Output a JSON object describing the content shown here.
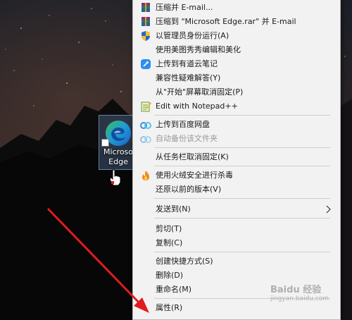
{
  "desktop": {
    "icon_label_line1": "Microso",
    "icon_label_line2": "Edge"
  },
  "context_menu": {
    "items": [
      {
        "label": "压缩并 E-mail...",
        "icon": "winrar-icon"
      },
      {
        "label": "压缩到 \"Microsoft Edge.rar\" 并 E-mail",
        "icon": "winrar-icon"
      },
      {
        "label": "以管理员身份运行(A)",
        "icon": "shield-icon"
      },
      {
        "label": "使用美图秀秀编辑和美化",
        "icon": ""
      },
      {
        "label": "上传到有道云笔记",
        "icon": "youdao-note-icon"
      },
      {
        "label": "兼容性疑难解答(Y)",
        "icon": ""
      },
      {
        "label": "从\"开始\"屏幕取消固定(P)",
        "icon": ""
      },
      {
        "label": "Edit with Notepad++",
        "icon": "notepad-plus-plus-icon"
      },
      {
        "label": "上传到百度网盘",
        "icon": "baidu-netdisk-icon"
      },
      {
        "label": "自动备份该文件夹",
        "icon": "baidu-netdisk-icon"
      },
      {
        "label": "从任务栏取消固定(K)",
        "icon": ""
      },
      {
        "label": "使用火绒安全进行杀毒",
        "icon": "huorong-icon"
      },
      {
        "label": "还原以前的版本(V)",
        "icon": ""
      },
      {
        "label": "发送到(N)",
        "icon": ""
      },
      {
        "label": "剪切(T)",
        "icon": ""
      },
      {
        "label": "复制(C)",
        "icon": ""
      },
      {
        "label": "创建快捷方式(S)",
        "icon": ""
      },
      {
        "label": "删除(D)",
        "icon": ""
      },
      {
        "label": "重命名(M)",
        "icon": ""
      },
      {
        "label": "属性(R)",
        "icon": ""
      }
    ],
    "disabled_item": "自动备份该文件夹",
    "submenu_item": "发送到(N)"
  },
  "watermark": {
    "text": "Baidu 经验",
    "sub": "jingyan.baidu.com"
  },
  "colors": {
    "arrow": "#e01c1c",
    "menu_bg": "#f2f2f2",
    "edge_blue": "#1e7fd6",
    "edge_green": "#3fbf5a"
  }
}
